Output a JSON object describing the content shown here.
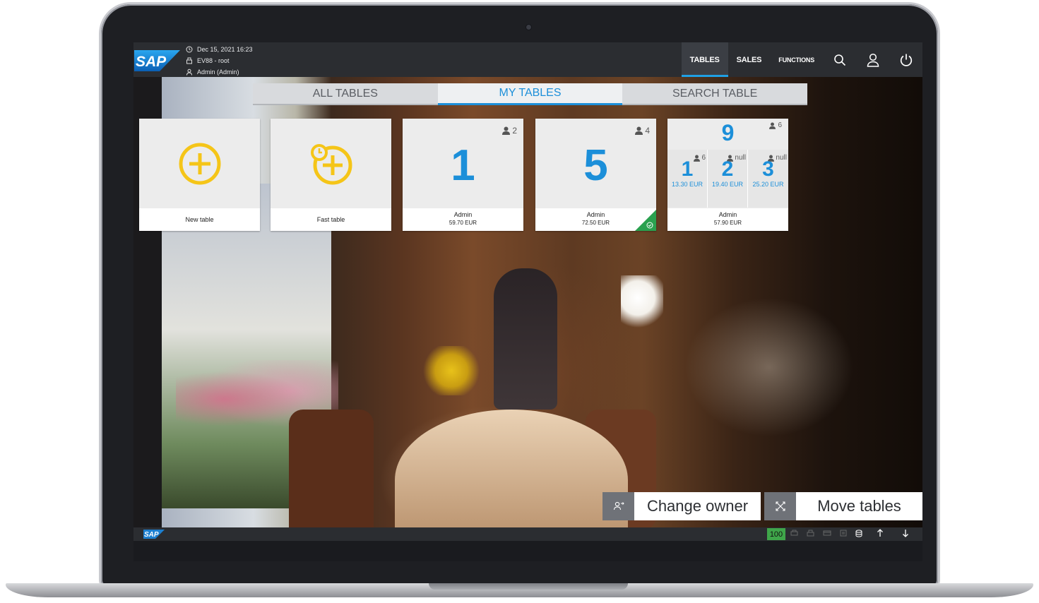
{
  "header": {
    "datetime": "Dec 15, 2021 16:23",
    "terminal": "EV88 - root",
    "user": "Admin (Admin)",
    "nav": [
      {
        "label": "TABLES",
        "active": true
      },
      {
        "label": "SALES",
        "active": false
      },
      {
        "label": "FUNCTIONS",
        "active": false
      }
    ],
    "icons": [
      "search-icon",
      "user-icon",
      "power-icon"
    ]
  },
  "segments": {
    "all": "ALL TABLES",
    "mine": "MY TABLES",
    "search": "SEARCH TABLE",
    "active": "MY TABLES"
  },
  "tiles": {
    "new_table": {
      "label": "New table",
      "icon": "plus-circle-icon"
    },
    "fast_table": {
      "label": "Fast table",
      "icon": "clock-plus-icon"
    },
    "table1": {
      "number": "1",
      "seats": "2",
      "owner": "Admin",
      "amount": "59.70 EUR"
    },
    "table5": {
      "number": "5",
      "seats": "4",
      "owner": "Admin",
      "amount": "72.50 EUR",
      "status": "check-icon"
    },
    "group9": {
      "number": "9",
      "seats": "6",
      "owner": "Admin",
      "amount": "57.90 EUR",
      "subtables": [
        {
          "number": "1",
          "seats": "6",
          "amount": "13.30 EUR"
        },
        {
          "number": "2",
          "seats": "null",
          "amount": "19.40 EUR"
        },
        {
          "number": "3",
          "seats": "null",
          "amount": "25.20 EUR"
        }
      ]
    }
  },
  "actions": {
    "change_owner": "Change owner",
    "move_tables": "Move tables"
  },
  "status_bar": {
    "counter": "100"
  },
  "colors": {
    "accent": "#1c8fd9",
    "yellow": "#f5c518",
    "green": "#2aa14f",
    "topbar": "#2b2d31"
  }
}
